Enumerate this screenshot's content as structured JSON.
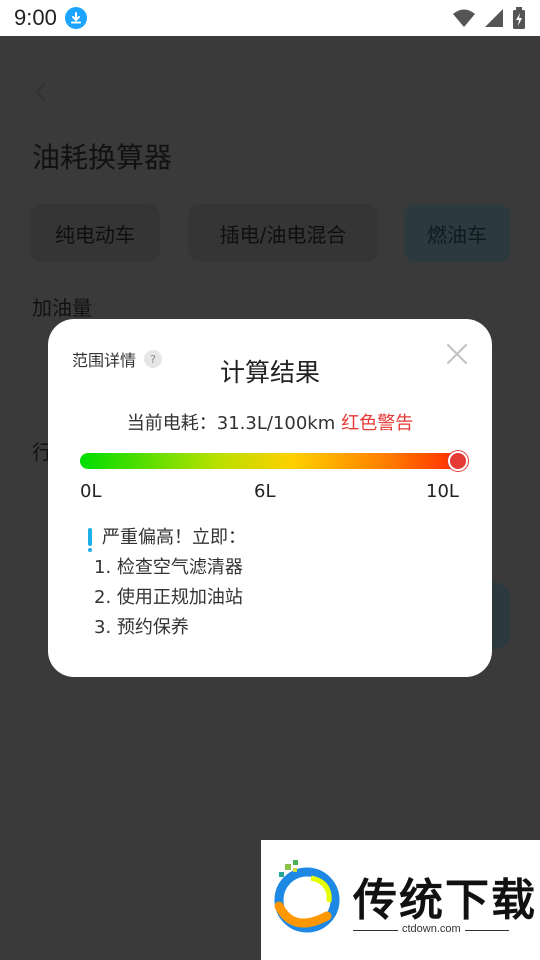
{
  "status_bar": {
    "time": "9:00"
  },
  "app": {
    "title": "油耗换算器",
    "tabs": [
      {
        "label": "纯电动车"
      },
      {
        "label": "插电/油电混合"
      },
      {
        "label": "燃油车",
        "selected": true
      }
    ],
    "fuel_label": "加油量",
    "partial_label": "行"
  },
  "modal": {
    "range_detail": "范围详情",
    "help_glyph": "?",
    "title": "计算结果",
    "current_prefix": "当前电耗：31.3L/100km",
    "warning": "红色警告",
    "level_fraction": 1.0,
    "gauge_ticks": [
      "0L",
      "6L",
      "10L"
    ],
    "advice_title": "严重偏高！立即：",
    "advice_steps": [
      "1. 检查空气滤清器",
      "2. 使用正规加油站",
      "3. 预约保养"
    ],
    "colors": {
      "warning": "#e53935",
      "accent": "#20b0e8"
    }
  },
  "watermark": {
    "brand": "传统下载",
    "url": "ctdown.com"
  }
}
